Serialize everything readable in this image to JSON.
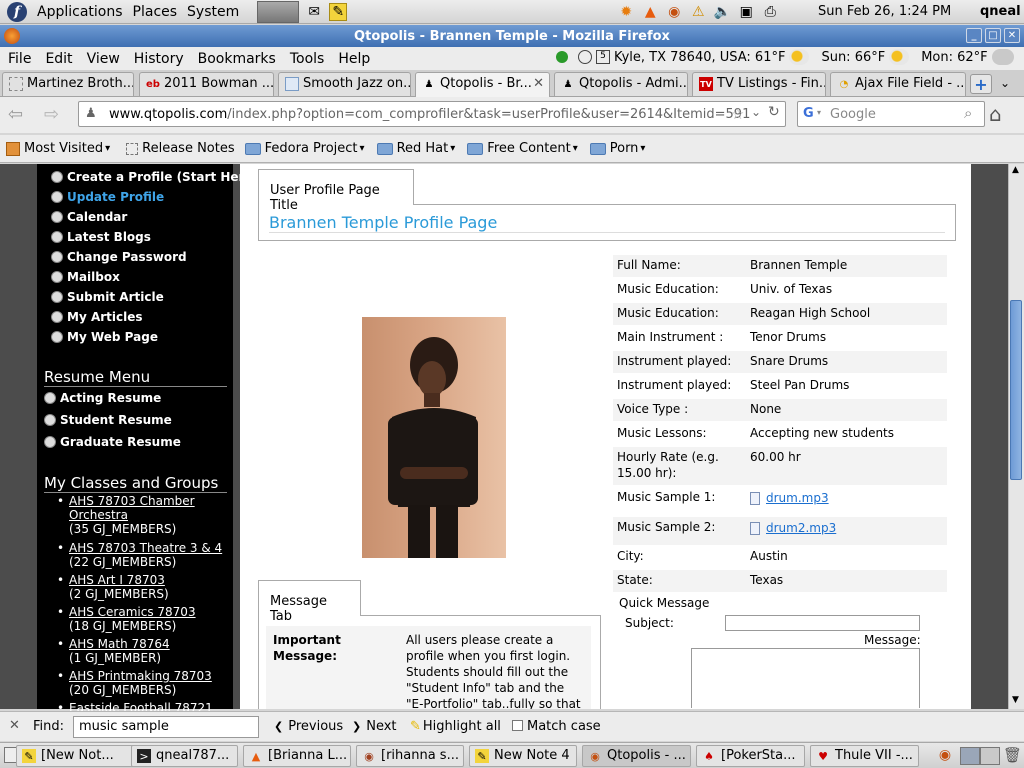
{
  "top_panel": {
    "menus": [
      "Applications",
      "Places",
      "System"
    ],
    "clock": "Sun Feb 26,  1:24 PM",
    "user": "qneal"
  },
  "window": {
    "title": "Qtopolis - Brannen Temple - Mozilla Firefox"
  },
  "menubar": [
    "File",
    "Edit",
    "View",
    "History",
    "Bookmarks",
    "Tools",
    "Help"
  ],
  "weather": {
    "location": "Kyle, TX 78640, USA: 61°F",
    "sun": "Sun: 66°F",
    "mon": "Mon: 62°F"
  },
  "tabs": [
    {
      "label": "Martinez Broth...",
      "icon": "page-icon"
    },
    {
      "label": "2011 Bowman ...",
      "icon": "ebay-icon"
    },
    {
      "label": "Smooth Jazz on...",
      "icon": "page-icon"
    },
    {
      "label": "Qtopolis - Br...",
      "icon": "qtopolis-icon",
      "active": true
    },
    {
      "label": "Qtopolis - Admi...",
      "icon": "qtopolis-icon"
    },
    {
      "label": "TV Listings - Fin...",
      "icon": "tv-icon"
    },
    {
      "label": "Ajax File Field - ...",
      "icon": "ajax-icon"
    }
  ],
  "url": {
    "domain": "www.qtopolis.com",
    "path": "/index.php?option=com_comprofiler&task=userProfile&user=2614&Itemid=591"
  },
  "search": {
    "placeholder": "Google"
  },
  "bookmarks": [
    {
      "label": "Most Visited",
      "icon": "star-icon"
    },
    {
      "label": "Release Notes",
      "icon": "page-icon"
    },
    {
      "label": "Fedora Project",
      "icon": "folder-icon"
    },
    {
      "label": "Red Hat",
      "icon": "folder-icon"
    },
    {
      "label": "Free Content",
      "icon": "folder-icon"
    },
    {
      "label": "Porn",
      "icon": "folder-icon"
    }
  ],
  "sidebar": {
    "items": [
      "Create a Profile (Start Here)",
      "Update Profile",
      "Calendar",
      "Latest Blogs",
      "Change Password",
      "Mailbox",
      "Submit Article",
      "My Articles",
      "My Web Page"
    ],
    "resume_title": "Resume Menu",
    "resume_items": [
      "Acting Resume",
      "Student Resume",
      "Graduate Resume"
    ],
    "classes_title": "My Classes and Groups",
    "classes": [
      {
        "name": "AHS 78703 Chamber",
        "name2": "Orchestra",
        "members": "(35 GJ_MEMBERS)"
      },
      {
        "name": "AHS 78703 Theatre 3 & 4",
        "members": "(22 GJ_MEMBERS)"
      },
      {
        "name": "AHS Art I 78703",
        "members": "(2 GJ_MEMBERS)"
      },
      {
        "name": "AHS Ceramics 78703",
        "members": "(18 GJ_MEMBERS)"
      },
      {
        "name": "AHS Math 78764",
        "members": "(1 GJ_MEMBER)"
      },
      {
        "name": "AHS Printmaking 78703",
        "members": "(20 GJ_MEMBERS)"
      },
      {
        "name": "Eastside Football 78721"
      }
    ]
  },
  "profile": {
    "tab_title": "User Profile Page Title",
    "heading": "Brannen Temple Profile Page",
    "fields": [
      {
        "label": "Full Name:",
        "value": "Brannen Temple"
      },
      {
        "label": "Music Education:",
        "value": "Univ. of Texas"
      },
      {
        "label": "Music Education:",
        "value": "Reagan High School"
      },
      {
        "label": "Main Instrument :",
        "value": "Tenor Drums"
      },
      {
        "label": "Instrument played:",
        "value": "Snare Drums"
      },
      {
        "label": "Instrument played:",
        "value": "Steel Pan Drums"
      },
      {
        "label": "Voice Type :",
        "value": "None"
      },
      {
        "label": "Music Lessons:",
        "value": "Accepting new students"
      },
      {
        "label": "Hourly Rate (e.g.",
        "label2": "15.00 hr):",
        "value": "60.00 hr"
      },
      {
        "label": "Music Sample 1:",
        "value": "drum.mp3"
      },
      {
        "label": "Music Sample 2:",
        "value": "drum2.mp3"
      },
      {
        "label": "City:",
        "value": "Austin"
      },
      {
        "label": "State:",
        "value": "Texas"
      }
    ],
    "quick_message": {
      "title": "Quick Message",
      "subject_label": "Subject:",
      "message_label": "Message:"
    }
  },
  "message_tab": {
    "tab_title": "Message Tab",
    "important_label": "Important",
    "important_label2": "Message:",
    "lines": [
      "All users please create a",
      "profile when you first login.",
      "Students should fill out the",
      "\"Student Info\" tab and the",
      "\"E-Portfolio\" tab..fully so that"
    ]
  },
  "findbar": {
    "label": "Find:",
    "value": "music sample",
    "previous": "Previous",
    "next": "Next",
    "highlight": "Highlight all",
    "match_case": "Match case"
  },
  "taskbar": [
    {
      "label": "[New Not...",
      "icon": "note-icon"
    },
    {
      "label": "qneal787...",
      "icon": "terminal-icon"
    },
    {
      "label": "[Brianna L...",
      "icon": "vlc-icon"
    },
    {
      "label": "[rihanna s...",
      "icon": "player-icon"
    },
    {
      "label": "New Note 4",
      "icon": "note-icon"
    },
    {
      "label": "Qtopolis - ...",
      "icon": "firefox-icon",
      "active": true
    },
    {
      "label": "[PokerSta...",
      "icon": "poker-icon"
    },
    {
      "label": "Thule VII -...",
      "icon": "card-icon"
    }
  ]
}
